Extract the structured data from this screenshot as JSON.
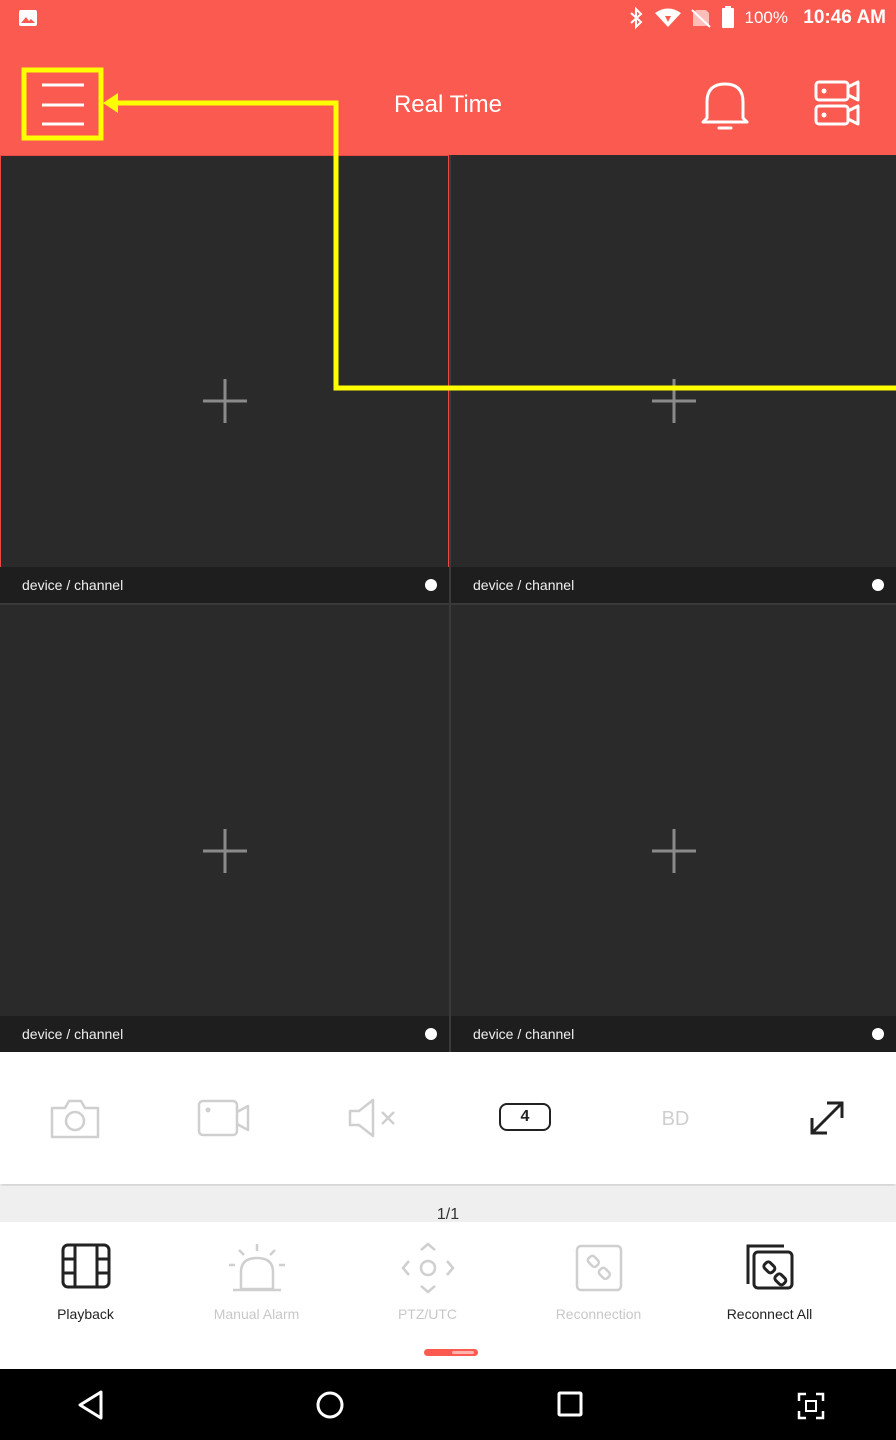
{
  "status_bar": {
    "battery": "100%",
    "time": "10:46 AM"
  },
  "header": {
    "title": "Real Time"
  },
  "grid": {
    "tiles": [
      {
        "label": "device / channel"
      },
      {
        "label": "device / channel"
      },
      {
        "label": "device / channel"
      },
      {
        "label": "device / channel"
      }
    ]
  },
  "toolbar": {
    "split_count": "4",
    "quality": "BD"
  },
  "pager": {
    "page": "1/1"
  },
  "actions": [
    {
      "label": "Playback",
      "enabled": true
    },
    {
      "label": "Manual Alarm",
      "enabled": false
    },
    {
      "label": "PTZ/UTC",
      "enabled": false
    },
    {
      "label": "Reconnection",
      "enabled": false
    },
    {
      "label": "Reconnect All",
      "enabled": true
    }
  ],
  "colors": {
    "accent": "#fa5a50",
    "tile_background": "#2a2a2a",
    "annotation": "#ffff00"
  }
}
